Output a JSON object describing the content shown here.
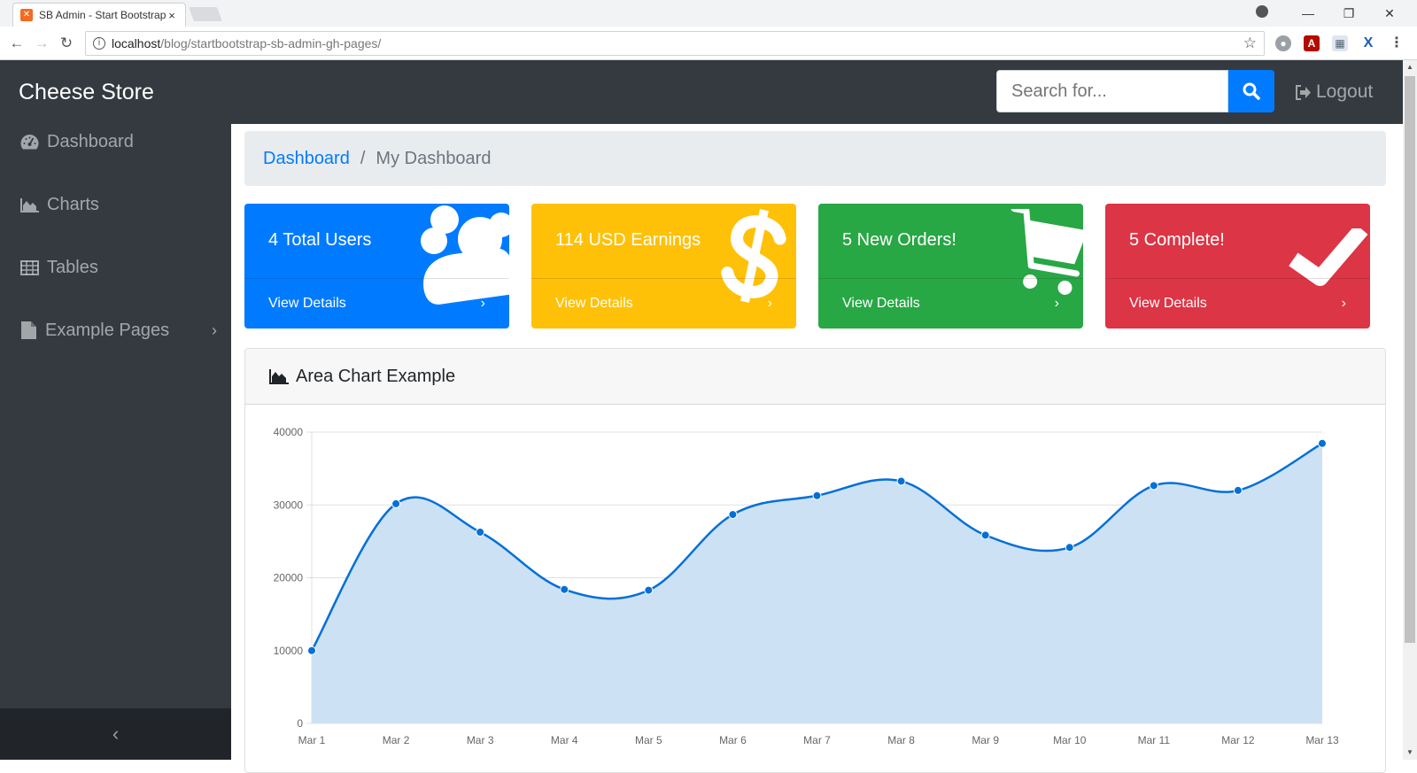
{
  "browser": {
    "tab_title": "SB Admin - Start Bootstrap Template",
    "url_host": "localhost",
    "url_path": "/blog/startbootstrap-sb-admin-gh-pages/"
  },
  "navbar": {
    "brand": "Cheese Store",
    "search_placeholder": "Search for...",
    "logout": "Logout"
  },
  "sidebar": {
    "items": [
      {
        "label": "Dashboard",
        "icon": "dashboard-icon"
      },
      {
        "label": "Charts",
        "icon": "area-chart-icon"
      },
      {
        "label": "Tables",
        "icon": "table-icon"
      },
      {
        "label": "Example Pages",
        "icon": "file-icon"
      }
    ],
    "toggle": "‹"
  },
  "breadcrumb": {
    "link": "Dashboard",
    "separator": "/",
    "active": "My Dashboard"
  },
  "cards": [
    {
      "text": "4 Total Users",
      "footer": "View Details",
      "color": "#007bff",
      "icon": "users-icon"
    },
    {
      "text": "114 USD Earnings",
      "footer": "View Details",
      "color": "#ffc107",
      "icon": "dollar-icon"
    },
    {
      "text": "5 New Orders!",
      "footer": "View Details",
      "color": "#28a745",
      "icon": "shopping-cart-icon"
    },
    {
      "text": "5 Complete!",
      "footer": "View Details",
      "color": "#dc3545",
      "icon": "check-icon"
    }
  ],
  "chart_card": {
    "title": "Area Chart Example"
  },
  "chart_data": {
    "type": "area",
    "categories": [
      "Mar 1",
      "Mar 2",
      "Mar 3",
      "Mar 4",
      "Mar 5",
      "Mar 6",
      "Mar 7",
      "Mar 8",
      "Mar 9",
      "Mar 10",
      "Mar 11",
      "Mar 12",
      "Mar 13"
    ],
    "values": [
      10000,
      30162,
      26263,
      18394,
      18287,
      28682,
      31274,
      33259,
      25849,
      24159,
      32651,
      31984,
      38451
    ],
    "ylim": [
      0,
      40000
    ],
    "yticks": [
      "0",
      "10000",
      "20000",
      "30000",
      "40000"
    ],
    "line_color": "#0270d7",
    "fill_color": "#cde1f5",
    "grid": true,
    "legend": "none"
  }
}
